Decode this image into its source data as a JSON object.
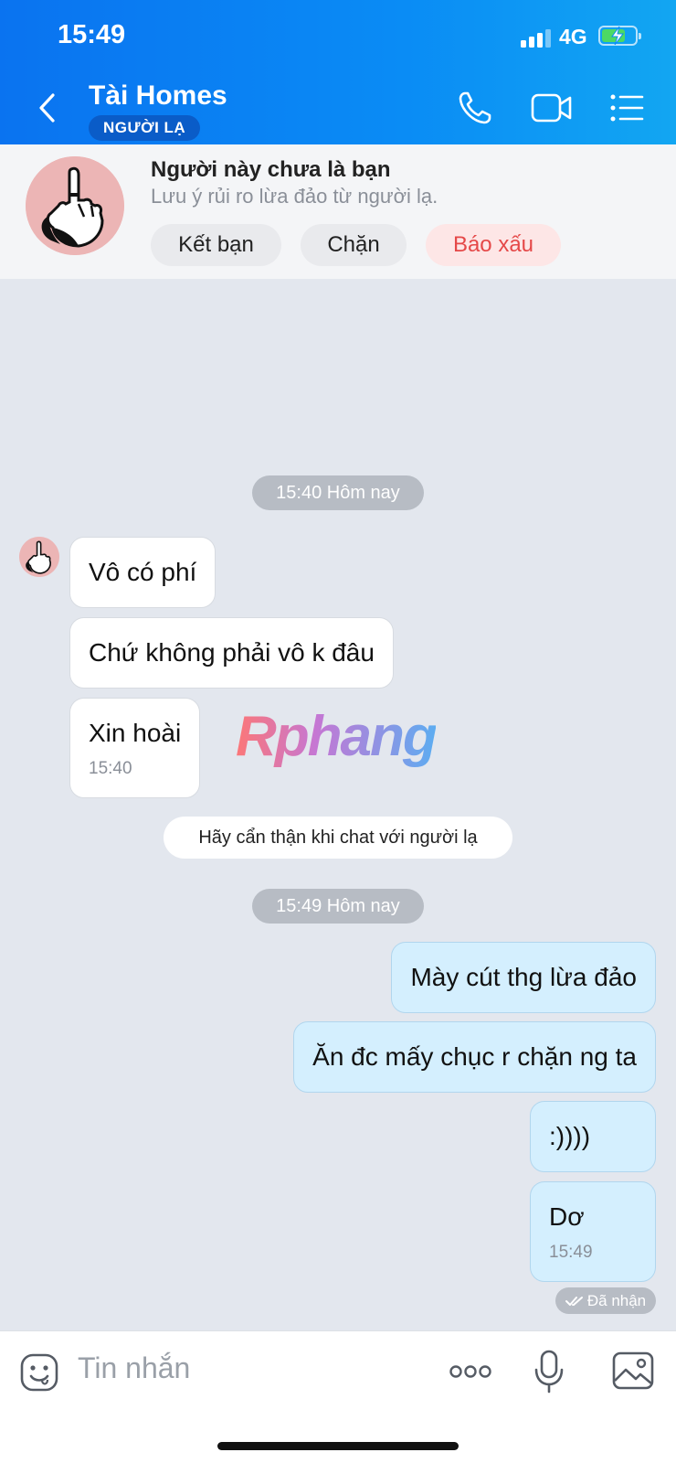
{
  "status_bar": {
    "time": "15:49",
    "network": "4G"
  },
  "header": {
    "title": "Tài Homes",
    "badge": "NGƯỜI LẠ"
  },
  "banner": {
    "title": "Người này chưa là bạn",
    "subtitle": "Lưu ý rủi ro lừa đảo từ người lạ.",
    "add_friend": "Kết bạn",
    "block": "Chặn",
    "report": "Báo xấu"
  },
  "chat": {
    "time_chip_1": "15:40 Hôm nay",
    "incoming": [
      {
        "text": "Vô có phí"
      },
      {
        "text": "Chứ không phải vô k đâu"
      },
      {
        "text": "Xin hoài",
        "time": "15:40"
      }
    ],
    "warning": "Hãy cẩn thận khi chat với người lạ",
    "time_chip_2": "15:49 Hôm nay",
    "outgoing": [
      {
        "text": "Mày cút thg lừa đảo"
      },
      {
        "text": "Ăn đc mấy chục r chặn ng ta"
      },
      {
        "text": ":))))"
      },
      {
        "text": "Dơ",
        "time": "15:49"
      }
    ],
    "received_status": "Đã nhận",
    "watermark": "Rphang"
  },
  "input": {
    "placeholder": "Tin nhắn"
  }
}
